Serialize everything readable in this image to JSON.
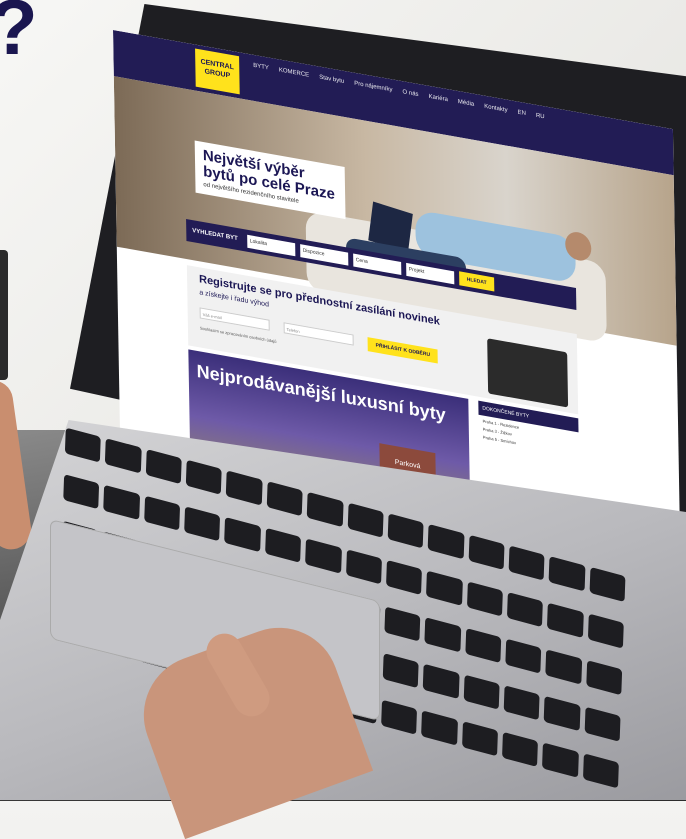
{
  "website": {
    "logo": "CENTRAL GROUP",
    "nav": [
      "BYTY",
      "KOMERCE",
      "Stav bytu",
      "Pro nájemníky",
      "O nás",
      "Kariéra",
      "Média",
      "Kontakty",
      "EN",
      "RU"
    ],
    "hero_headline": "Největší výběr bytů po celé Praze",
    "hero_subline": "od největšího rezidenčního stavitele",
    "search_label": "VYHLEDAT BYT",
    "filters": [
      "Lokalita",
      "Dispozice",
      "Cena",
      "Projekt"
    ],
    "search_button": "HLEDAT",
    "registration_title": "Registrujte se pro přednostní zasílání novinek",
    "registration_sub": "a získejte i řadu výhod",
    "email_placeholder": "Váš e-mail",
    "phone_placeholder": "Telefon",
    "consent_text": "Souhlasím se zpracováním osobních údajů",
    "register_button": "PŘIHLÁSIT K ODBĚRU",
    "promo_text": "Nejprodávanější luxusní byty",
    "promo_badge": "Parková",
    "sidebar_header": "DOKONČENÉ BYTY",
    "sidebar_items": [
      "Praha 1 - Rezidence",
      "Praha 3 - Žižkov",
      "Praha 5 - Smíchov"
    ]
  },
  "corner_text": "?"
}
